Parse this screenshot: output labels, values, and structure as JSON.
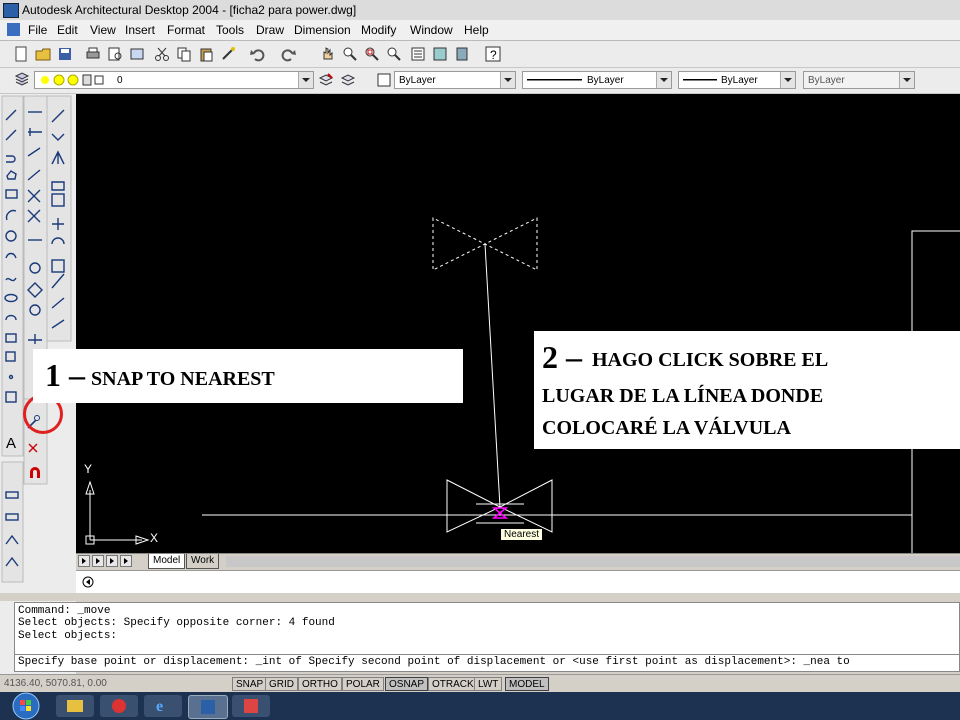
{
  "window": {
    "title": "Autodesk Architectural Desktop 2004 - [ficha2 para power.dwg]"
  },
  "menu": [
    "File",
    "Edit",
    "View",
    "Insert",
    "Format",
    "Tools",
    "Draw",
    "Dimension",
    "Modify",
    "Window",
    "Help"
  ],
  "layer_toolbar": {
    "layer_value": "0",
    "color_value": "ByLayer",
    "linetype_value": "ByLayer",
    "lineweight_value": "ByLayer",
    "plotstyle_value": "ByLayer"
  },
  "canvas": {
    "snap_tooltip": "Nearest",
    "ucs_x_label": "X",
    "ucs_y_label": "Y"
  },
  "tabs": {
    "model": "Model",
    "work": "Work"
  },
  "command_lines": [
    "Command: _move",
    "Select objects: Specify opposite corner: 4 found",
    "Select objects:",
    "Specify base point or displacement: _int of Specify second point of displacement or <use first point as displacement>: _nea to"
  ],
  "status": {
    "coordinates": "4136.40, 5070.81, 0.00",
    "buttons": [
      "SNAP",
      "GRID",
      "ORTHO",
      "POLAR",
      "OSNAP",
      "OTRACK",
      "LWT",
      "MODEL"
    ]
  },
  "annotations": {
    "step1_number": "1 –",
    "step1_text": "SNAP  TO NEAREST",
    "step2_number": "2 –",
    "step2_line1": "HAGO CLICK SOBRE EL",
    "step2_line2": "LUGAR DE LA LÍNEA DONDE",
    "step2_line3": "COLOCARÉ LA VÁLVULA"
  },
  "colors": {
    "canvas_bg": "#000000",
    "highlight_circle": "#e02020",
    "snap_marker": "#ff00ff",
    "taskbar": "#1d3150"
  }
}
